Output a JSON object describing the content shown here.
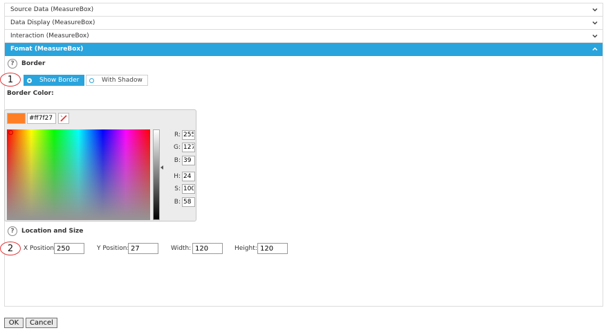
{
  "accordion": [
    {
      "label": "Source Data (MeasureBox)",
      "active": false
    },
    {
      "label": "Data Display (MeasureBox)",
      "active": false
    },
    {
      "label": "Interaction (MeasureBox)",
      "active": false
    },
    {
      "label": "Fomat (MeasureBox)",
      "active": true
    }
  ],
  "border_section": {
    "title": "Border",
    "help": "?",
    "marker": "1",
    "show_border_label": "Show Border",
    "with_shadow_label": "With Shadow",
    "border_color_label": "Border Color:"
  },
  "color_picker": {
    "hex": "#ff7f27",
    "swatch_color": "#ff7f27",
    "r_label": "R:",
    "r": "255",
    "g_label": "G:",
    "g": "127",
    "b_label": "B:",
    "b": "39",
    "h_label": "H:",
    "h": "24",
    "s_label": "S:",
    "s": "100",
    "v_label": "B:",
    "v": "58"
  },
  "location_section": {
    "title": "Location and Size",
    "help": "?",
    "marker": "2",
    "x_label": "X Position:",
    "x_value": "250",
    "y_label": "Y Position:",
    "y_value": "27",
    "width_label": "Width:",
    "width_value": "120",
    "height_label": "Height:",
    "height_value": "120"
  },
  "footer": {
    "ok_label": "OK",
    "cancel_label": "Cancel"
  },
  "colors": {
    "accent": "#2aa4dc",
    "marker_ring": "#dd3333"
  }
}
